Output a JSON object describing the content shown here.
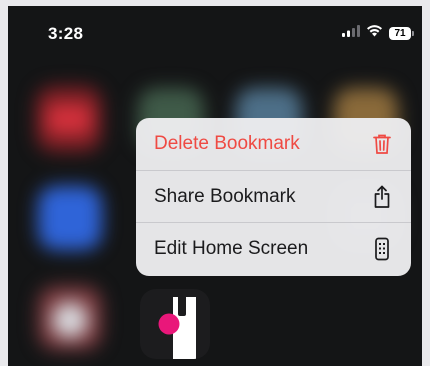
{
  "status_bar": {
    "time": "3:28",
    "battery": "71"
  },
  "context_menu": {
    "items": [
      {
        "label": "Delete Bookmark",
        "icon": "trash-icon",
        "color": "#ef4a43"
      },
      {
        "label": "Share Bookmark",
        "icon": "share-icon"
      },
      {
        "label": "Edit Home Screen",
        "icon": "phone-icon"
      }
    ]
  },
  "colors": {
    "destructive": "#ef4a43",
    "app_icon_dot": "#e9177a"
  }
}
